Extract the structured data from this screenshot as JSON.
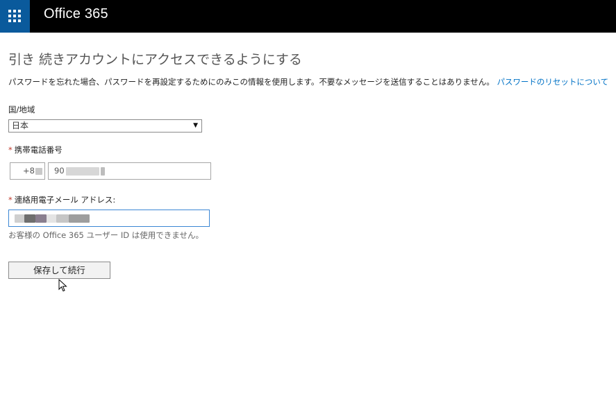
{
  "header": {
    "app_title": "Office 365",
    "app_launcher_icon": "waffle-grid-icon",
    "bar_color": "#000000",
    "launcher_color": "#0a5a9c"
  },
  "main": {
    "heading": "引き 続きアカウントにアクセスできるようにする",
    "description": "パスワードを忘れた場合、パスワードを再設定するためにのみこの情報を使用します。不要なメッセージを送信することはありません。",
    "reset_link": "パスワードのリセットについて",
    "link_color": "#0072c6"
  },
  "form": {
    "country": {
      "label": "国/地域",
      "selected": "日本"
    },
    "mobile": {
      "required_mark": "*",
      "label": "携帯電話番号",
      "country_code": "+8",
      "number_prefix": "90"
    },
    "email": {
      "required_mark": "*",
      "label": "連絡用電子メール アドレス:",
      "hint": "お客様の Office 365 ユーザー ID は使用できません。"
    },
    "save_button": "保存して続行"
  }
}
